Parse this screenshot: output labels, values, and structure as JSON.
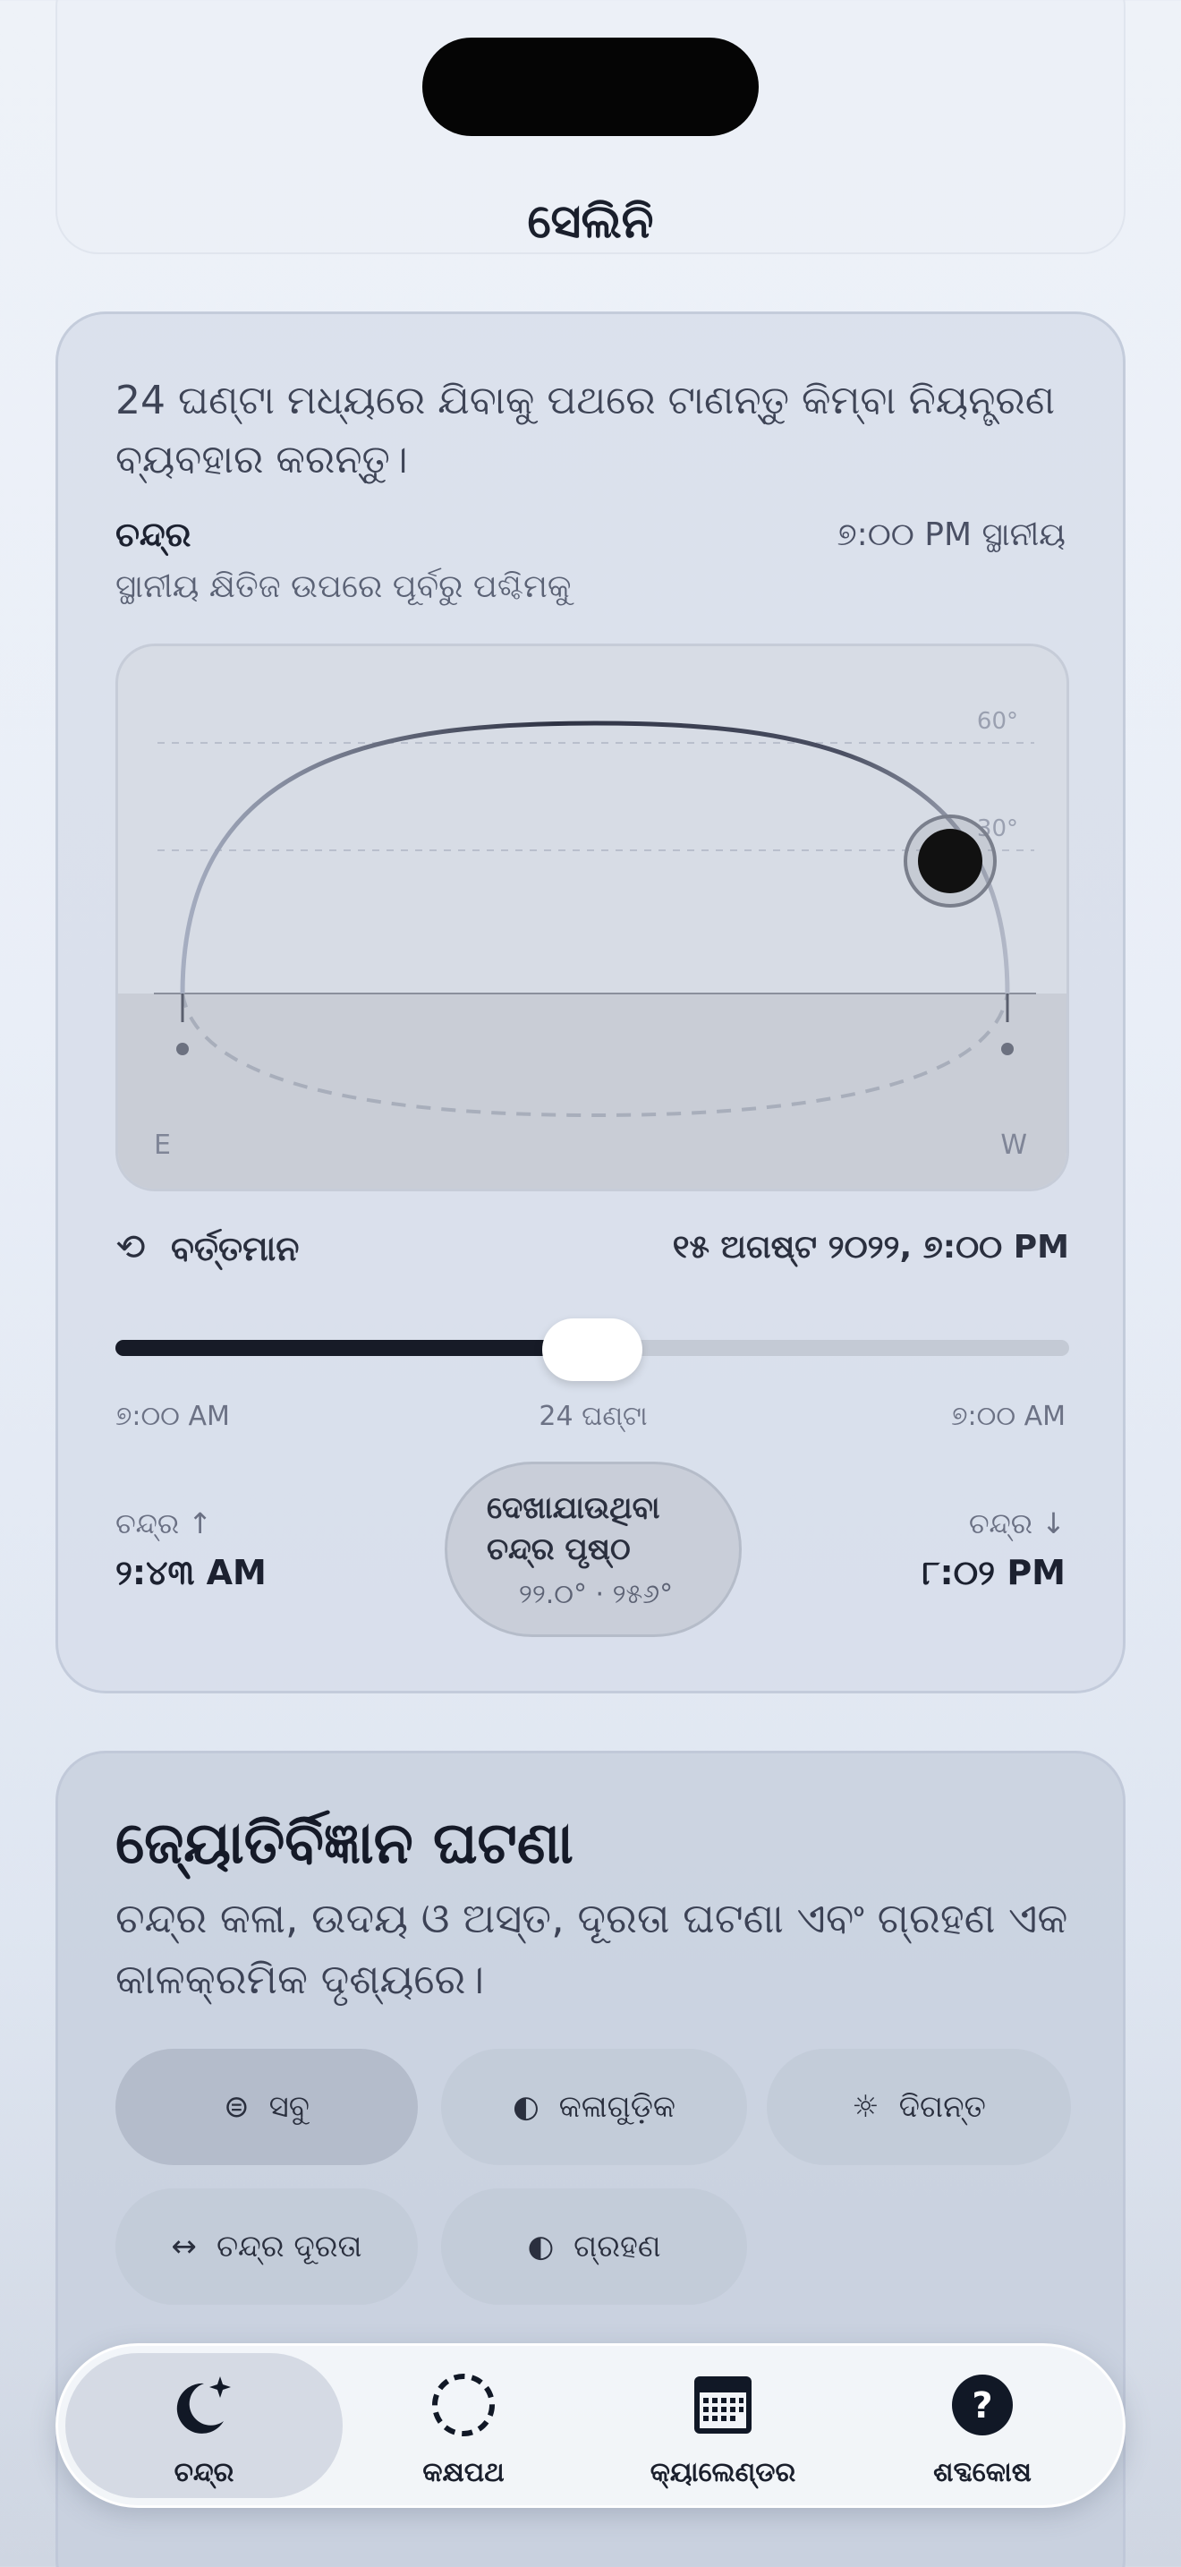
{
  "app": {
    "title": "ସେଲିନି"
  },
  "moon_card": {
    "instruction": "24 ଘଣ୍ଟା ମଧ୍ୟରେ ଯିବାକୁ ପଥରେ ଟାଣନ୍ତୁ କିମ୍ବା ନିୟନ୍ତ୍ରଣ ବ୍ୟବହାର କରନ୍ତୁ।",
    "object_label": "ଚନ୍ଦ୍ର",
    "local_time": "୭:୦୦ PM ସ୍ଥାନୀୟ",
    "path_description": "ସ୍ଥାନୀୟ କ୍ଷିତିଜ ଉପରେ ପୂର୍ବରୁ ପଶ୍ଚିମକୁ",
    "sky": {
      "altitude_60": "60°",
      "altitude_30": "30°",
      "east": "E",
      "west": "W",
      "moon_position_fraction": 0.86
    },
    "current": {
      "icon": "reset-icon",
      "label": "ବର୍ତ୍ତମାନ",
      "datetime": "୧୫ ଅଗଷ୍ଟ ୨୦୨୨, ୭:୦୦ PM"
    },
    "slider": {
      "value_fraction": 0.5,
      "start_label": "୭:୦୦ AM",
      "center_label": "24 ଘଣ୍ଟା",
      "end_label": "୭:୦୦ AM"
    },
    "moonrise": {
      "label": "ଚନ୍ଦ୍ର ↑",
      "time": "୨:୪୩ AM"
    },
    "moonset": {
      "label": "ଚନ୍ଦ୍ର ↓",
      "time": "୮:୦୨ PM"
    },
    "visible_surface": {
      "title": "ଦେଖାଯାଉଥିବା ଚନ୍ଦ୍ର ପୃଷ୍ଠ",
      "values": "୨୨.୦° · ୨୫୬°"
    }
  },
  "events_card": {
    "title": "ଜ୍ୟୋତିର୍ବିଜ୍ଞାନ ଘଟଣା",
    "description": "ଚନ୍ଦ୍ର କଳା, ଉଦୟ ଓ ଅସ୍ତ, ଦୂରତା ଘଟଣା ଏବଂ ଗ୍ରହଣ ଏକ କାଳକ୍ରମିକ ଦୃଶ୍ୟରେ।",
    "filters": [
      {
        "label": "ସବୁ",
        "icon": "list-icon",
        "active": true
      },
      {
        "label": "କଳାଗୁଡ଼ିକ",
        "icon": "half-moon-icon",
        "active": false
      },
      {
        "label": "ଦିଗନ୍ତ",
        "icon": "horizon-icon",
        "active": false
      },
      {
        "label": "ଚନ୍ଦ୍ର ଦୂରତା",
        "icon": "arrows-horizontal-icon",
        "active": false
      },
      {
        "label": "ଗ୍ରହଣ",
        "icon": "half-moon-icon",
        "active": false
      }
    ]
  },
  "tabbar": {
    "tabs": [
      {
        "label": "ଚନ୍ଦ୍ର",
        "icon": "moon-stars-icon",
        "active": true
      },
      {
        "label": "କକ୍ଷପଥ",
        "icon": "orbit-icon",
        "active": false
      },
      {
        "label": "କ୍ୟାଲେଣ୍ଡର",
        "icon": "calendar-icon",
        "active": false
      },
      {
        "label": "ଶବ୍ଦକୋଷ",
        "icon": "question-icon",
        "active": false
      }
    ]
  },
  "colors": {
    "accent_dark": "#171b27",
    "card_bg": "#d6dde9",
    "moon_glyph": "#111111"
  }
}
